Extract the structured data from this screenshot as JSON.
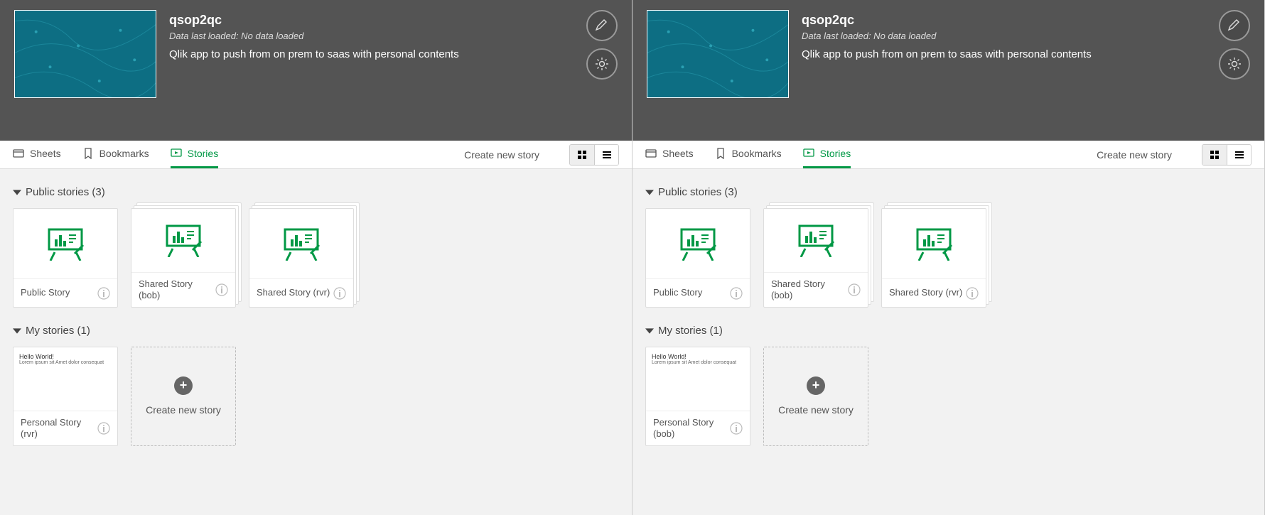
{
  "panes": [
    {
      "header": {
        "title": "qsop2qc",
        "subtitle": "Data last loaded: No data loaded",
        "description": "Qlik app to push from on prem to saas with personal contents"
      },
      "tabs": {
        "sheets": "Sheets",
        "bookmarks": "Bookmarks",
        "stories": "Stories"
      },
      "create_link": "Create new story",
      "sections": {
        "public": {
          "title": "Public stories (3)",
          "items": [
            {
              "name": "Public Story"
            },
            {
              "name": "Shared Story (bob)"
            },
            {
              "name": "Shared Story (rvr)"
            }
          ]
        },
        "my": {
          "title": "My stories (1)",
          "items": [
            {
              "name": "Personal Story (rvr)",
              "preview_title": "Hello World!",
              "preview_body": "Lorem ipsum sit\nAmet dolor consequat"
            }
          ],
          "create_label": "Create new story"
        }
      }
    },
    {
      "header": {
        "title": "qsop2qc",
        "subtitle": "Data last loaded: No data loaded",
        "description": "Qlik app to push from on prem to saas with personal contents"
      },
      "tabs": {
        "sheets": "Sheets",
        "bookmarks": "Bookmarks",
        "stories": "Stories"
      },
      "create_link": "Create new story",
      "sections": {
        "public": {
          "title": "Public stories (3)",
          "items": [
            {
              "name": "Public Story"
            },
            {
              "name": "Shared Story (bob)"
            },
            {
              "name": "Shared Story (rvr)"
            }
          ]
        },
        "my": {
          "title": "My stories (1)",
          "items": [
            {
              "name": "Personal Story (bob)",
              "preview_title": "Hello World!",
              "preview_body": "Lorem ipsum sit\nAmet dolor consequat"
            }
          ],
          "create_label": "Create new story"
        }
      }
    }
  ]
}
